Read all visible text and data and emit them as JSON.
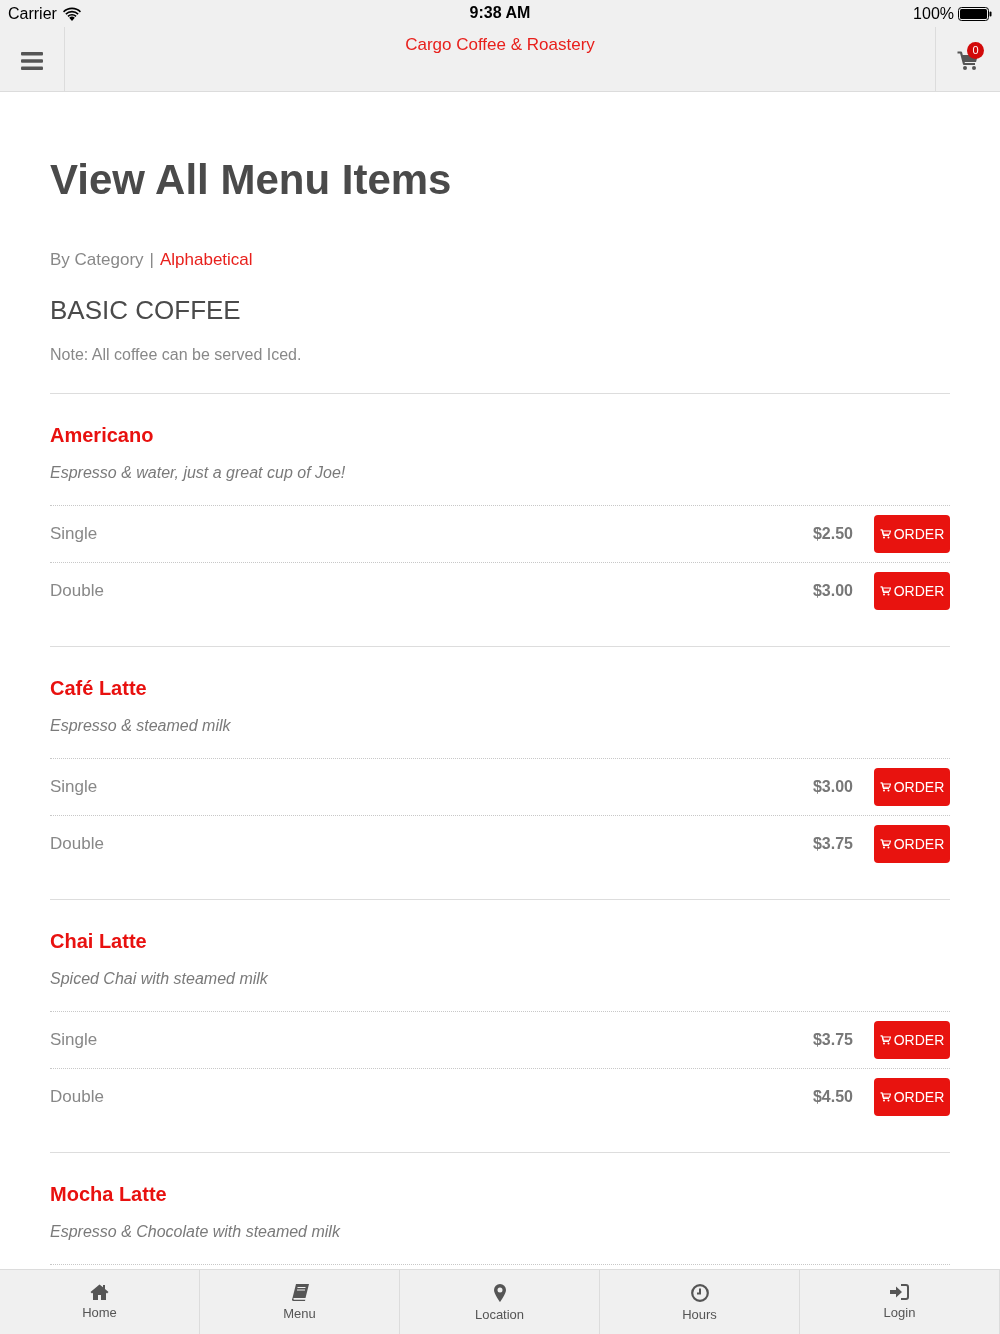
{
  "status_bar": {
    "carrier": "Carrier",
    "time": "9:38 AM",
    "battery": "100%"
  },
  "header": {
    "title": "Cargo Coffee & Roastery",
    "cart_count": "0"
  },
  "page": {
    "title": "View All Menu Items",
    "sort_options": [
      {
        "label": "By Category",
        "selected": true
      },
      {
        "label": "Alphabetical",
        "selected": false
      }
    ],
    "sort_separator": "|"
  },
  "sections": [
    {
      "title": "BASIC COFFEE",
      "note": "Note: All coffee can be served Iced.",
      "items": [
        {
          "name": "Americano",
          "description": "Espresso & water, just a great cup of Joe!",
          "options": [
            {
              "size": "Single",
              "price": "$2.50",
              "button": "ORDER"
            },
            {
              "size": "Double",
              "price": "$3.00",
              "button": "ORDER"
            }
          ]
        },
        {
          "name": "Café Latte",
          "description": "Espresso & steamed milk",
          "options": [
            {
              "size": "Single",
              "price": "$3.00",
              "button": "ORDER"
            },
            {
              "size": "Double",
              "price": "$3.75",
              "button": "ORDER"
            }
          ]
        },
        {
          "name": "Chai Latte",
          "description": "Spiced Chai with steamed milk",
          "options": [
            {
              "size": "Single",
              "price": "$3.75",
              "button": "ORDER"
            },
            {
              "size": "Double",
              "price": "$4.50",
              "button": "ORDER"
            }
          ]
        },
        {
          "name": "Mocha Latte",
          "description": "Espresso & Chocolate with steamed milk"
        }
      ]
    }
  ],
  "tab_bar": [
    {
      "kind": "home",
      "label": "Home",
      "selected": false
    },
    {
      "kind": "menu",
      "label": "Menu",
      "selected": false
    },
    {
      "kind": "location",
      "label": "Location",
      "selected": false
    },
    {
      "kind": "hours",
      "label": "Hours",
      "selected": false
    },
    {
      "kind": "login",
      "label": "Login",
      "selected": false
    }
  ]
}
